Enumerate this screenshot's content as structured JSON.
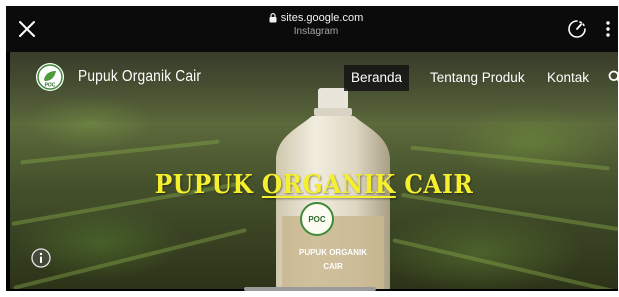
{
  "browser": {
    "url": "sites.google.com",
    "subtitle": "Instagram"
  },
  "site": {
    "title": "Pupuk Organik Cair",
    "logo_text": "POC",
    "nav": [
      {
        "label": "Beranda",
        "active": true
      },
      {
        "label": "Tentang Produk",
        "active": false
      },
      {
        "label": "Kontak",
        "active": false
      }
    ]
  },
  "hero": {
    "headline_part1": "PUPUK ",
    "headline_part2": "ORGANIK",
    "headline_part3": " CAIR",
    "bottle_logo": "POC",
    "bottle_label_line1": "PUPUK ORGANIK",
    "bottle_label_line2": "CAIR"
  },
  "colors": {
    "headline": "#f5ef2e",
    "nav_active_bg": "#141414",
    "topbar": "#0b0b0b"
  },
  "icons": [
    "close-icon",
    "lock-icon",
    "speed-icon",
    "more-vertical-icon",
    "search-icon",
    "info-icon"
  ]
}
